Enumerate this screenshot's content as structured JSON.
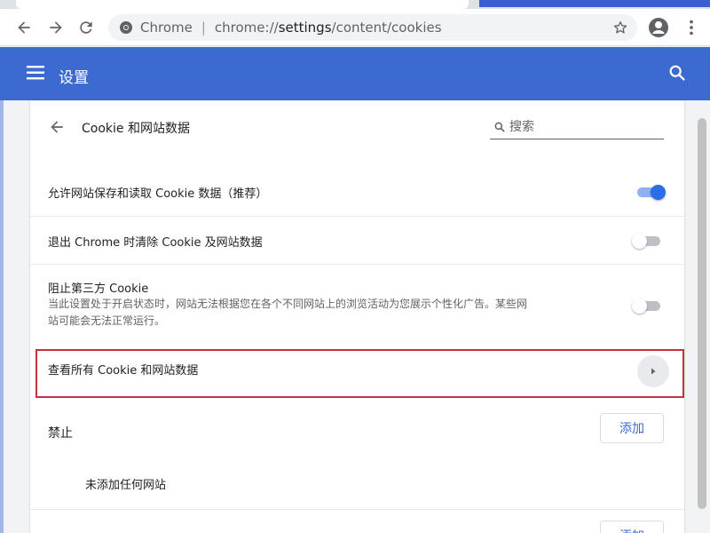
{
  "browser": {
    "site_chip": "Chrome",
    "separator": "|",
    "url_prefix": "chrome://",
    "url_bold": "settings",
    "url_suffix": "/content/cookies"
  },
  "header": {
    "title": "设置"
  },
  "subpage": {
    "title": "Cookie 和网站数据",
    "search_placeholder": "搜索"
  },
  "settings": {
    "allow_cookies": {
      "label": "允许网站保存和读取 Cookie 数据（推荐）",
      "enabled": true
    },
    "clear_on_exit": {
      "label": "退出 Chrome 时清除 Cookie 及网站数据",
      "enabled": false
    },
    "block_third_party": {
      "label": "阻止第三方 Cookie",
      "description_line1": "当此设置处于开启状态时，网站无法根据您在各个不同网站上的浏览活动为您展示个性化广告。某些网",
      "description_line2": "站可能会无法正常运行。",
      "enabled": false
    },
    "see_all": {
      "label": "查看所有 Cookie 和网站数据"
    }
  },
  "block_section": {
    "label": "禁止",
    "add_label": "添加",
    "empty_text": "未添加任何网站"
  },
  "next_section": {
    "add_label": "添加"
  },
  "colors": {
    "header_blue": "#3d6ad1",
    "toggle_on": "#2c6ee8",
    "highlight_red": "#c0343a"
  }
}
